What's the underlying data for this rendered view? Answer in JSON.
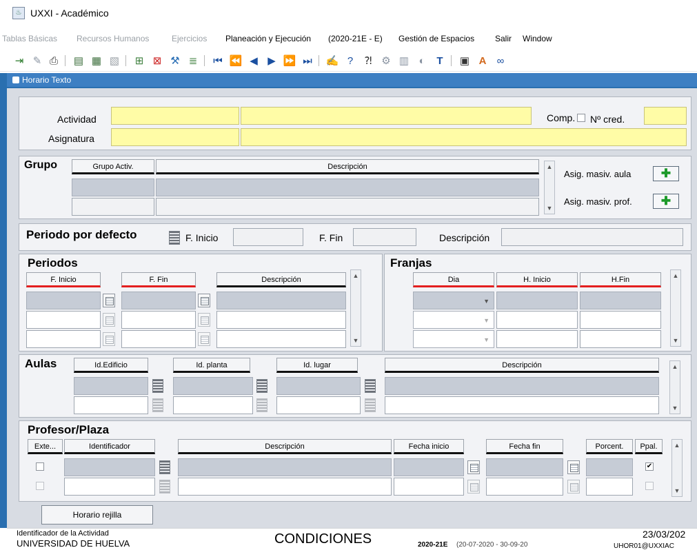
{
  "window": {
    "title": "UXXI - Académico"
  },
  "menu": {
    "items": [
      {
        "label": "Tablas Básicas",
        "disabled": true
      },
      {
        "label": "Recursos Humanos",
        "disabled": true
      },
      {
        "label": "Ejercicios",
        "disabled": true
      },
      {
        "label": "Planeación y Ejecución",
        "disabled": false
      },
      {
        "label": "(2020-21E - E)",
        "disabled": false
      },
      {
        "label": "Gestión de Espacios",
        "disabled": false
      },
      {
        "label": "Salir",
        "disabled": false
      },
      {
        "label": "Window",
        "disabled": false
      }
    ]
  },
  "form": {
    "title": "Horario Texto"
  },
  "header": {
    "actividad_label": "Actividad",
    "asignatura_label": "Asignatura",
    "comp_label": "Comp.",
    "ncred_label": "Nº cred."
  },
  "grupo": {
    "title": "Grupo",
    "col_grupo": "Grupo Activ.",
    "col_desc": "Descripción",
    "btn_aula": "Asig. masiv. aula",
    "btn_prof": "Asig. masiv. prof."
  },
  "periodo": {
    "title": "Periodo por defecto",
    "f_inicio": "F. Inicio",
    "f_fin": "F. Fin",
    "descripcion": "Descripción"
  },
  "periodos": {
    "title": "Periodos",
    "col_inicio": "F. Inicio",
    "col_fin": "F. Fin",
    "col_desc": "Descripción"
  },
  "franjas": {
    "title": "Franjas",
    "col_dia": "Dia",
    "col_hinicio": "H. Inicio",
    "col_hfin": "H.Fin"
  },
  "aulas": {
    "title": "Aulas",
    "col_edificio": "Id.Edificio",
    "col_planta": "Id. planta",
    "col_lugar": "Id. lugar",
    "col_desc": "Descripción"
  },
  "profesor": {
    "title": "Profesor/Plaza",
    "col_exte": "Exte...",
    "col_ident": "Identificador",
    "col_desc": "Descripción",
    "col_finicio": "Fecha inicio",
    "col_ffin": "Fecha fin",
    "col_porc": "Porcent.",
    "col_ppal": "Ppal."
  },
  "buttons": {
    "horario_rejilla": "Horario rejilla"
  },
  "status": {
    "field_hint": "Identificador de la Actividad",
    "org": "UNIVERSIDAD DE HUELVA",
    "mode": "CONDICIONES",
    "period_code": "2020-21E",
    "period_range": "(20-07-2020  -  30-09-20",
    "date": "23/03/202",
    "user": "UHOR01@UXXIAC"
  }
}
